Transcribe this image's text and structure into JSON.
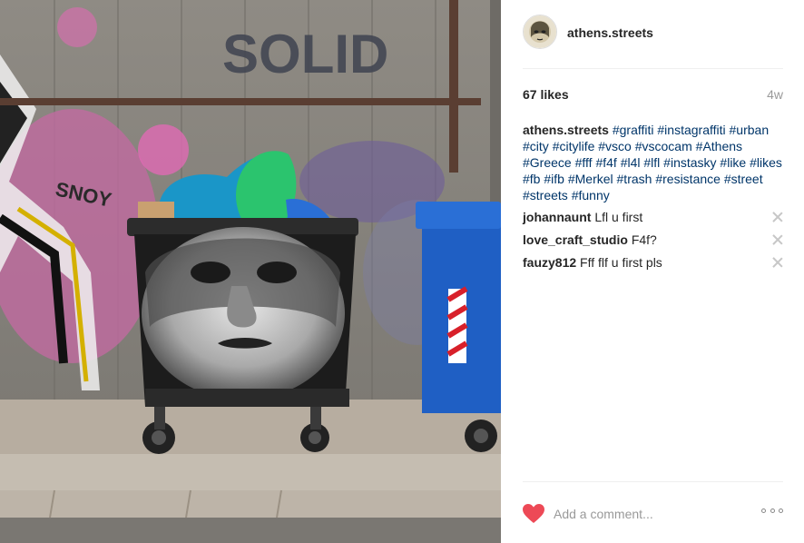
{
  "post": {
    "username": "athens.streets",
    "likes": "67 likes",
    "age": "4w",
    "caption": {
      "username": "athens.streets",
      "hashtags": [
        "#graffiti",
        "#instagraffiti",
        "#urban",
        "#city",
        "#citylife",
        "#vsco",
        "#vscocam",
        "#Athens",
        "#Greece",
        "#fff",
        "#f4f",
        "#l4l",
        "#lfl",
        "#instasky",
        "#like",
        "#likes",
        "#fb",
        "#ifb",
        "#Merkel",
        "#trash",
        "#resistance",
        "#street",
        "#streets",
        "#funny"
      ]
    },
    "comments": [
      {
        "user": "johannaunt",
        "text": "Lfl u first"
      },
      {
        "user": "love_craft_studio",
        "text": "F4f?"
      },
      {
        "user": "fauzy812",
        "text": "Fff flf u first pls"
      }
    ],
    "add_comment_placeholder": "Add a comment...",
    "photo_graffiti_text": "SOLID",
    "heart_color": "#ed4956",
    "link_color": "#003569"
  }
}
